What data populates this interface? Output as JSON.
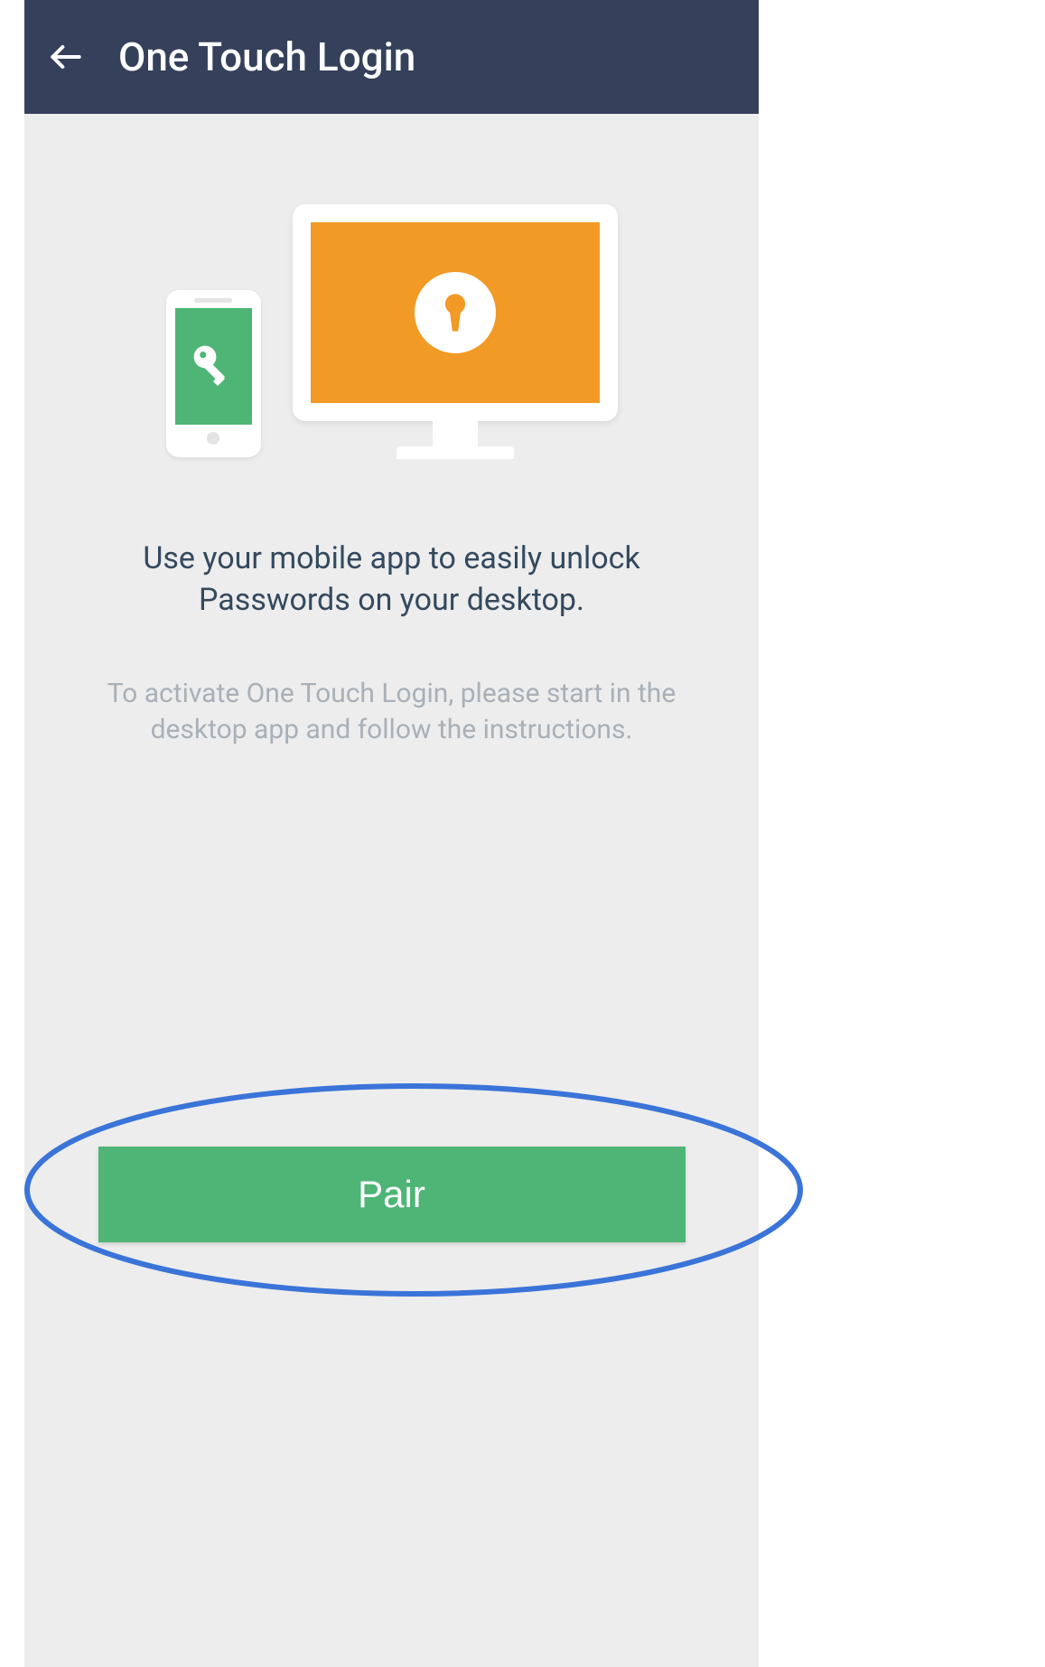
{
  "header": {
    "title": "One Touch Login"
  },
  "content": {
    "instruction": "Use your mobile app to easily unlock Passwords on your desktop.",
    "sub_instruction": "To activate One Touch Login, please start in the desktop app and follow the instructions."
  },
  "actions": {
    "pair_label": "Pair"
  },
  "colors": {
    "header_bg": "#35415b",
    "accent_green": "#4fb577",
    "accent_orange": "#f19a25",
    "highlight_blue": "#3b74d8"
  }
}
